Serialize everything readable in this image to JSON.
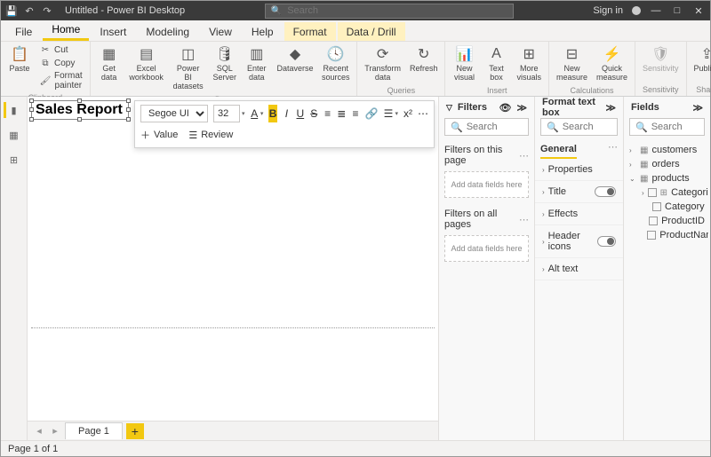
{
  "titlebar": {
    "title": "Untitled - Power BI Desktop",
    "search_placeholder": "Search",
    "signin": "Sign in"
  },
  "menu": {
    "file": "File",
    "home": "Home",
    "insert": "Insert",
    "modeling": "Modeling",
    "view": "View",
    "help": "Help",
    "format": "Format",
    "datadrill": "Data / Drill"
  },
  "ribbon": {
    "paste": "Paste",
    "cut": "Cut",
    "copy": "Copy",
    "format_painter": "Format painter",
    "clipboard": "Clipboard",
    "get_data": "Get\ndata",
    "excel": "Excel\nworkbook",
    "pbi_datasets": "Power BI\ndatasets",
    "sql": "SQL\nServer",
    "enter_data": "Enter\ndata",
    "dataverse": "Dataverse",
    "recent": "Recent\nsources",
    "data": "Data",
    "transform": "Transform\ndata",
    "refresh": "Refresh",
    "queries": "Queries",
    "new_visual": "New\nvisual",
    "text_box": "Text\nbox",
    "more_visuals": "More\nvisuals",
    "insert": "Insert",
    "new_measure": "New\nmeasure",
    "quick_measure": "Quick\nmeasure",
    "calculations": "Calculations",
    "sensitivity": "Sensitivity",
    "sensitivity_g": "Sensitivity",
    "publish": "Publish",
    "share": "Share"
  },
  "textbox": {
    "content": "Sales Report"
  },
  "toolbar": {
    "font": "Segoe UI",
    "size": "32",
    "value": "Value",
    "review": "Review"
  },
  "filters": {
    "title": "Filters",
    "search_placeholder": "Search",
    "on_page": "Filters on this page",
    "on_all": "Filters on all pages",
    "drop": "Add data fields here"
  },
  "formatpane": {
    "title": "Format text box",
    "search_placeholder": "Search",
    "tab_general": "General",
    "sect_properties": "Properties",
    "sect_title": "Title",
    "sect_effects": "Effects",
    "sect_header": "Header icons",
    "sect_alt": "Alt text"
  },
  "fields": {
    "title": "Fields",
    "search_placeholder": "Search",
    "tables": {
      "customers": "customers",
      "orders": "orders",
      "products": "products"
    },
    "products_fields": {
      "cat_pro": "Categorized Pro...",
      "category": "Category",
      "productid": "ProductID",
      "productname": "ProductName"
    }
  },
  "pages": {
    "page1": "Page 1"
  },
  "status": {
    "text": "Page 1 of 1"
  }
}
